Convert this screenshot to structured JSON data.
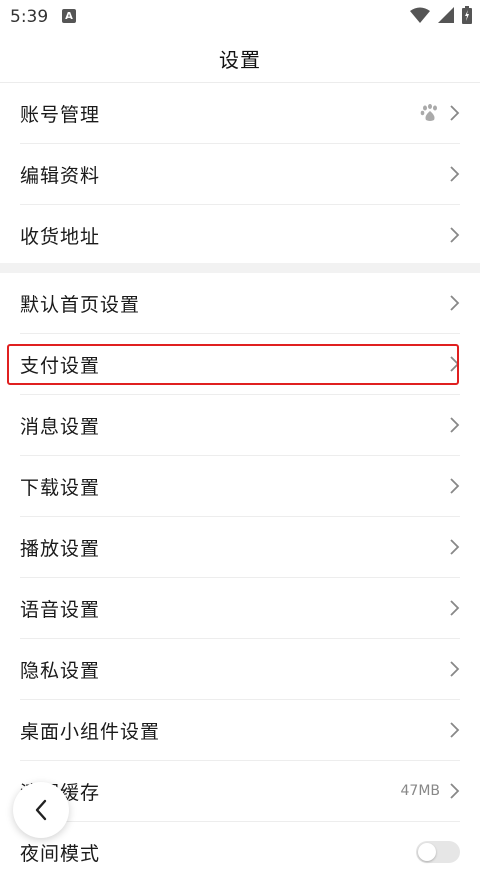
{
  "status_bar": {
    "time": "5:39",
    "notification_badge": "A"
  },
  "header": {
    "title": "设置"
  },
  "group1": [
    {
      "label": "账号管理",
      "icon": "baidu-paw-icon"
    },
    {
      "label": "编辑资料"
    },
    {
      "label": "收货地址"
    }
  ],
  "group2": [
    {
      "label": "默认首页设置"
    },
    {
      "label": "支付设置",
      "highlighted": true
    },
    {
      "label": "消息设置"
    },
    {
      "label": "下载设置"
    },
    {
      "label": "播放设置"
    },
    {
      "label": "语音设置"
    },
    {
      "label": "隐私设置"
    },
    {
      "label": "桌面小组件设置"
    },
    {
      "label": "清理缓存",
      "value": "47MB"
    },
    {
      "label": "夜间模式",
      "toggle": false
    }
  ],
  "colors": {
    "highlight": "#e02020",
    "divider": "#f2f2f2"
  }
}
